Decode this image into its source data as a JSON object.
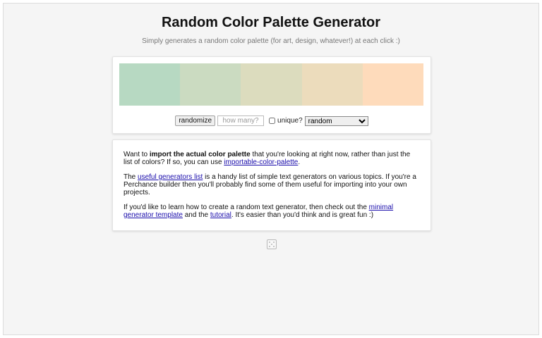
{
  "page": {
    "title": "Random Color Palette Generator",
    "subtitle": "Simply generates a random color palette (for art, design, whatever!) at each click :)"
  },
  "palette": {
    "colors": [
      "#b7d9c2",
      "#cbdbc1",
      "#dcdcbe",
      "#ecdcbc",
      "#fedbbb"
    ]
  },
  "controls": {
    "randomize_label": "randomize",
    "count_placeholder": "how many?",
    "unique_label": "unique?",
    "unique_checked": false,
    "mode_selected": "random"
  },
  "info": {
    "p1_a": "Want to ",
    "p1_bold": "import the actual color palette",
    "p1_b": " that you're looking at right now, rather than just the list of colors? If so, you can use ",
    "p1_link": "importable-color-palette",
    "p1_c": ".",
    "p2_a": "The ",
    "p2_link": "useful generators list",
    "p2_b": " is a handy list of simple text generators on various topics. If you're a Perchance builder then you'll probably find some of them useful for importing into your own projects.",
    "p3_a": "If you'd like to learn how to create a random text generator, then check out the ",
    "p3_link1": "minimal generator template",
    "p3_b": " and the ",
    "p3_link2": "tutorial",
    "p3_c": ". It's easier than you'd think and is great fun :)"
  },
  "footer": {
    "icon": "dice-icon"
  }
}
